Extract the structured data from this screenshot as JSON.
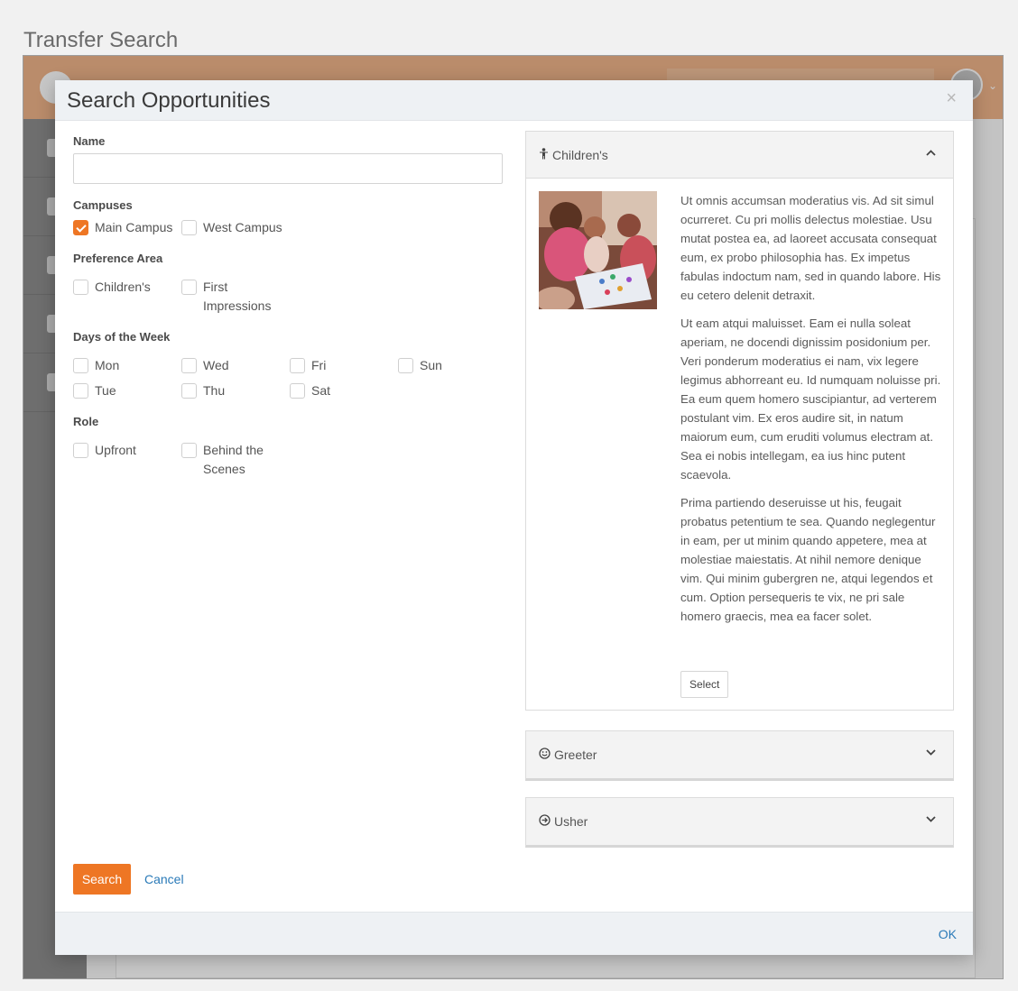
{
  "page": {
    "title": "Transfer Search"
  },
  "modal": {
    "title": "Search Opportunities",
    "close_label": "×",
    "ok_label": "OK"
  },
  "form": {
    "name_label": "Name",
    "name_value": "",
    "campuses_label": "Campuses",
    "campuses": [
      {
        "label": "Main Campus",
        "checked": true
      },
      {
        "label": "West Campus",
        "checked": false
      }
    ],
    "preference_label": "Preference Area",
    "preferences": [
      {
        "label": "Children's",
        "checked": false
      },
      {
        "label": "First Impressions",
        "checked": false
      }
    ],
    "days_label": "Days of the Week",
    "days": [
      {
        "label": "Mon",
        "checked": false
      },
      {
        "label": "Wed",
        "checked": false
      },
      {
        "label": "Fri",
        "checked": false
      },
      {
        "label": "Sun",
        "checked": false
      },
      {
        "label": "Tue",
        "checked": false
      },
      {
        "label": "Thu",
        "checked": false
      },
      {
        "label": "Sat",
        "checked": false
      }
    ],
    "role_label": "Role",
    "roles": [
      {
        "label": "Upfront",
        "checked": false
      },
      {
        "label": "Behind the Scenes",
        "checked": false
      }
    ],
    "search_label": "Search",
    "cancel_label": "Cancel"
  },
  "opportunities": [
    {
      "title": "Children's",
      "icon": "child-icon",
      "expanded": true,
      "paragraphs": [
        "Ut omnis accumsan moderatius vis. Ad sit simul ocurreret. Cu pri mollis delectus molestiae. Usu mutat postea ea, ad laoreet accusata consequat eum, ex probo philosophia has. Ex impetus fabulas indoctum nam, sed in quando labore. His eu cetero delenit detraxit.",
        "Ut eam atqui maluisset. Eam ei nulla soleat aperiam, ne docendi dignissim posidonium per. Veri ponderum moderatius ei nam, vix legere legimus abhorreant eu. Id numquam noluisse pri. Ea eum quem homero suscipiantur, ad verterem postulant vim. Ex eros audire sit, in natum maiorum eum, cum eruditi volumus electram at. Sea ei nobis intellegam, ea ius hinc putent scaevola.",
        "Prima partiendo deseruisse ut his, feugait probatus petentium te sea. Quando neglegentur in eam, per ut minim quando appetere, mea at molestiae maiestatis. At nihil nemore denique vim. Qui minim gubergren ne, atqui legendos et cum. Option persequeris te vix, ne pri sale homero graecis, mea ea facer solet."
      ],
      "select_label": "Select"
    },
    {
      "title": "Greeter",
      "icon": "smile-icon",
      "expanded": false
    },
    {
      "title": "Usher",
      "icon": "arrow-circle-right-icon",
      "expanded": false
    }
  ],
  "colors": {
    "accent": "#ee7624",
    "link": "#2a7ab8",
    "header_bar": "#efb48a"
  }
}
